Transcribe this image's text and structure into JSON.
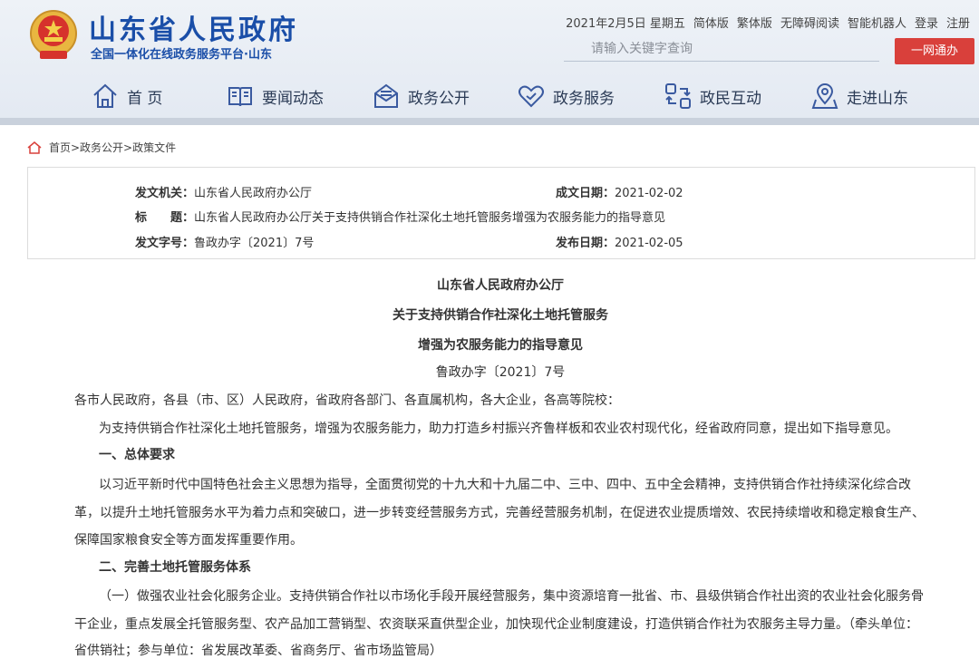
{
  "header": {
    "site_title": "山东省人民政府",
    "site_subtitle": "全国一体化在线政务服务平台·山东",
    "top_links": [
      "2021年2月5日 星期五",
      "简体版",
      "繁体版",
      "无障碍阅读",
      "智能机器人",
      "登录",
      "注册"
    ],
    "search_placeholder": "请输入关键字查询",
    "ywt_label": "一网通办"
  },
  "nav": {
    "items": [
      {
        "label": "首 页",
        "icon": "home-icon"
      },
      {
        "label": "要闻动态",
        "icon": "book-icon"
      },
      {
        "label": "政务公开",
        "icon": "mail-icon"
      },
      {
        "label": "政务服务",
        "icon": "heart-icon"
      },
      {
        "label": "政民互动",
        "icon": "exchange-icon"
      },
      {
        "label": "走进山东",
        "icon": "map-pin-icon"
      }
    ]
  },
  "breadcrumb": "首页>政务公开>政策文件",
  "meta": {
    "issuer_label": "发文机关：",
    "issuer": "山东省人民政府办公厅",
    "date_label": "成文日期：",
    "date": "2021-02-02",
    "title_label": "标　　题：",
    "title": "山东省人民政府办公厅关于支持供销合作社深化土地托管服务增强为农服务能力的指导意见",
    "docno_label": "发文字号：",
    "docno": "鲁政办字〔2021〕7号",
    "pubdate_label": "发布日期：",
    "pubdate": "2021-02-05"
  },
  "document": {
    "title1": "山东省人民政府办公厅",
    "title2": "关于支持供销合作社深化土地托管服务",
    "title3": "增强为农服务能力的指导意见",
    "docno": "鲁政办字〔2021〕7号",
    "salutation": "各市人民政府，各县（市、区）人民政府，省政府各部门、各直属机构，各大企业，各高等院校：",
    "intro": "为支持供销合作社深化土地托管服务，增强为农服务能力，助力打造乡村振兴齐鲁样板和农业农村现代化，经省政府同意，提出如下指导意见。",
    "h1": "一、总体要求",
    "p1_l1": "以习近平新时代中国特色社会主义思想为指导，全面贯彻党的十九大和十九届二中、三中、四中、五中全会精神，支持供销合作社持续深化综合改",
    "p1_l2": "革，以提升土地托管服务水平为着力点和突破口，进一步转变经营服务方式，完善经营服务机制，在促进农业提质增效、农民持续增收和稳定粮食生产、",
    "p1_l3": "保障国家粮食安全等方面发挥重要作用。",
    "h2": "二、完善土地托管服务体系",
    "p2_l1": "（一）做强农业社会化服务企业。支持供销合作社以市场化手段开展经营服务，集中资源培育一批省、市、县级供销合作社出资的农业社会化服务骨",
    "p2_l2": "干企业，重点发展全托管服务型、农产品加工营销型、农资联采直供型企业，加快现代企业制度建设，打造供销合作社为农服务主导力量。（牵头单位：",
    "p2_l3": "省供销社；参与单位：省发展改革委、省商务厅、省市场监管局）"
  }
}
